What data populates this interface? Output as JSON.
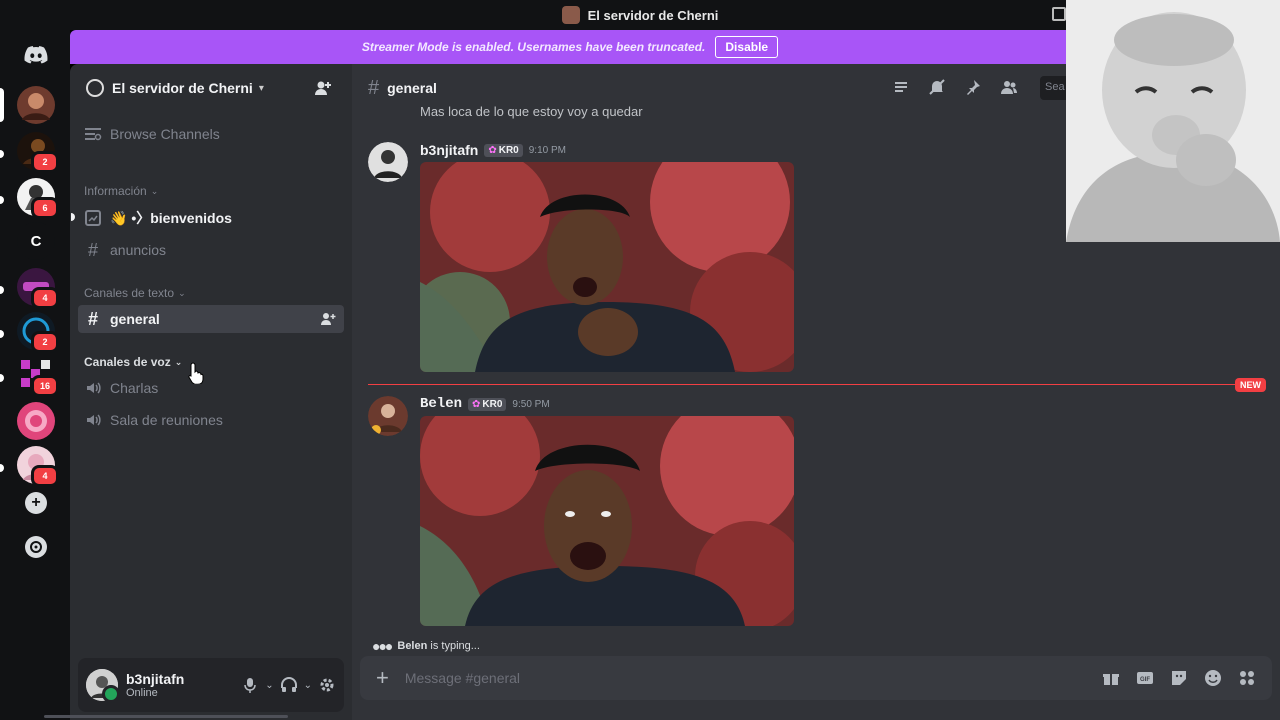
{
  "window": {
    "title": "El servidor de Cherni"
  },
  "banner": {
    "text": "Streamer Mode is enabled. Usernames have been truncated.",
    "button": "Disable"
  },
  "rail": {
    "home_icon": "discord-logo-icon",
    "servers": [
      {
        "color": "#7a4a3a",
        "badge": "",
        "letter": ""
      },
      {
        "color": "#2a1a10",
        "badge": "2",
        "letter": ""
      },
      {
        "color": "#e8e8e8",
        "badge": "6",
        "letter": ""
      },
      {
        "color": "#111214",
        "badge": "",
        "letter": "C"
      },
      {
        "color": "#8a3b8a",
        "badge": "4",
        "letter": ""
      },
      {
        "color": "#1c3a4a",
        "badge": "2",
        "letter": ""
      },
      {
        "color": "#7b2a7b",
        "badge": "16",
        "letter": ""
      },
      {
        "color": "#e0457b",
        "badge": "",
        "letter": ""
      },
      {
        "color": "#e7b4c4",
        "badge": "4",
        "letter": ""
      }
    ]
  },
  "sidebar": {
    "server_name": "El servidor de Cherni",
    "browse": "Browse Channels",
    "categories": {
      "info": "Información",
      "text": "Canales de texto",
      "voice": "Canales de voz"
    },
    "channels": {
      "welcome": "👋 •〉bienvenidos",
      "announcements": "anuncios",
      "general": "general",
      "voice1": "Charlas",
      "voice2": "Sala de reuniones"
    }
  },
  "user": {
    "name": "b3njitafn",
    "status": "Online"
  },
  "chat": {
    "channel": "general",
    "search_placeholder": "Sea",
    "previous_message": "Mas loca de lo que estoy voy a quedar",
    "messages": [
      {
        "author": "b3njitafn",
        "tag": "KR0",
        "time": "9:10 PM"
      },
      {
        "author": "Belen",
        "tag": "KR0",
        "time": "9:50 PM"
      }
    ],
    "new_label": "NEW",
    "typing_user": "Belen",
    "typing_suffix": " is typing...",
    "composer_placeholder": "Message #general"
  },
  "colors": {
    "accent": "#a855f7",
    "mention": "#f23f43",
    "online": "#23a55a"
  }
}
